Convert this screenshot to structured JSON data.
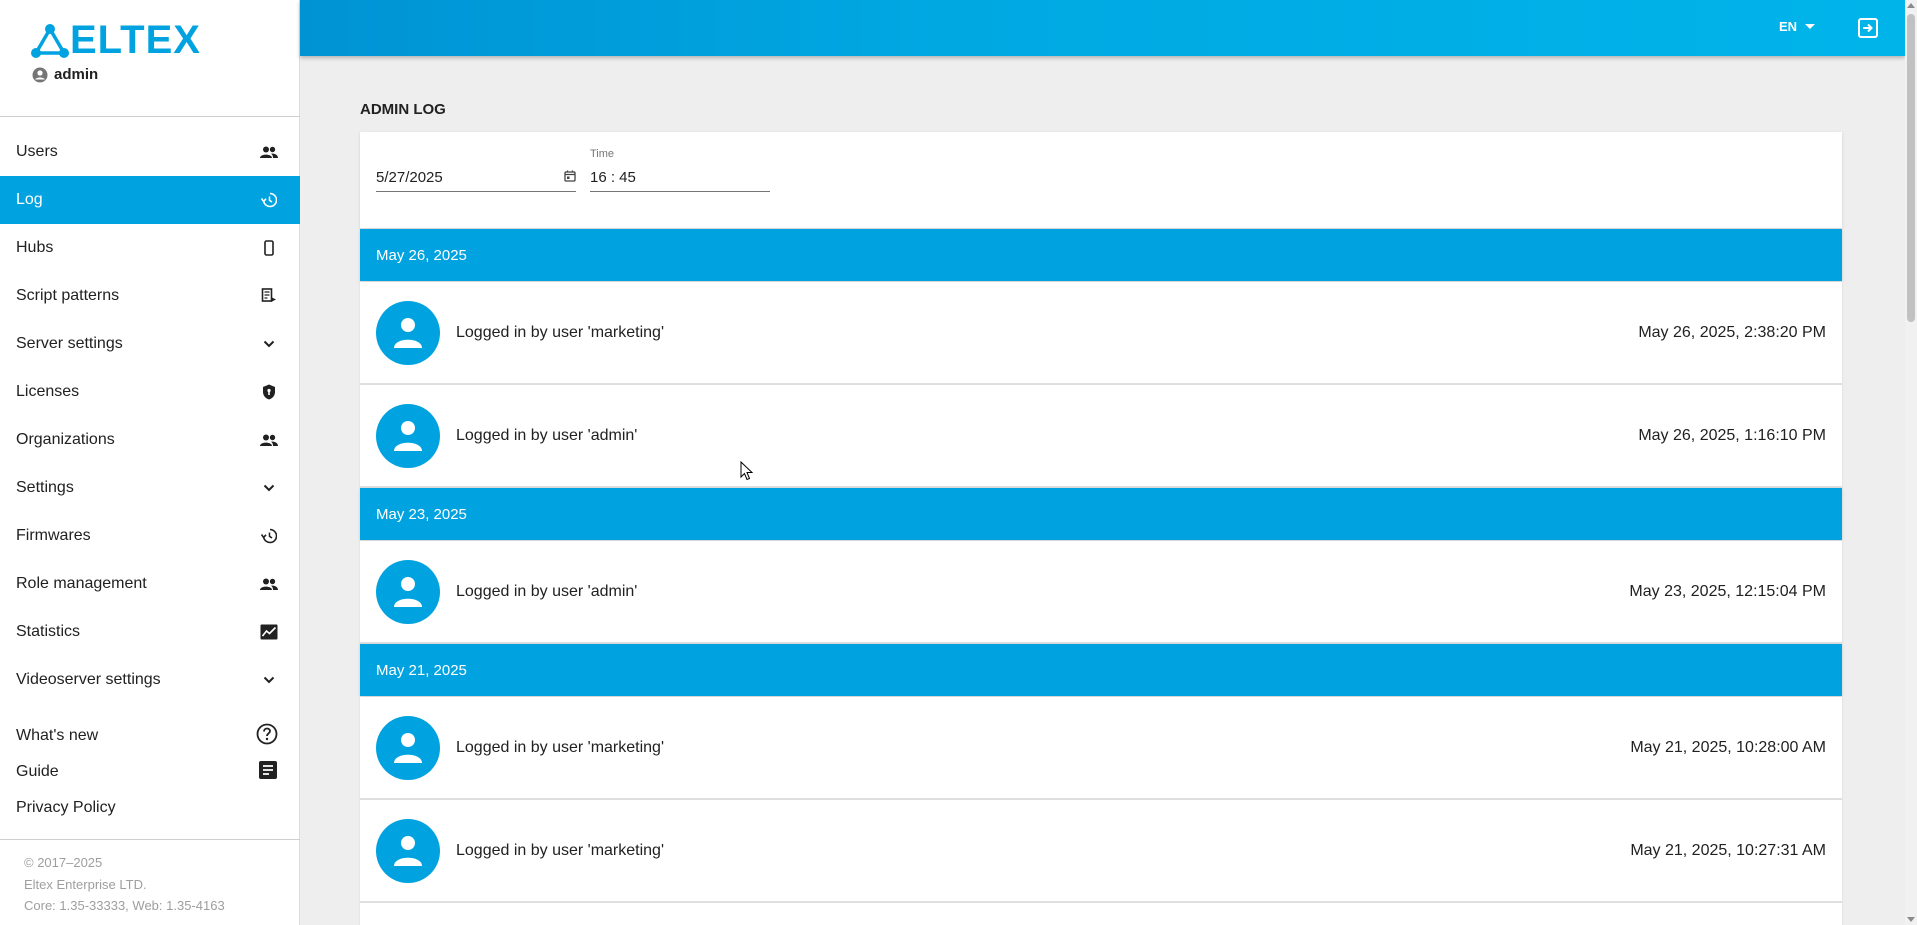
{
  "brand": {
    "logo_text": "ELTEX",
    "accent": "#00a3e0"
  },
  "user": {
    "name": "admin"
  },
  "sidebar": {
    "items": [
      {
        "label": "Users",
        "icon": "people-icon",
        "active": false
      },
      {
        "label": "Log",
        "icon": "history-icon",
        "active": true
      },
      {
        "label": "Hubs",
        "icon": "phone-icon",
        "active": false
      },
      {
        "label": "Script patterns",
        "icon": "script-icon",
        "active": false
      },
      {
        "label": "Server settings",
        "icon": "chevron-down-icon",
        "active": false
      },
      {
        "label": "Licenses",
        "icon": "shield-icon",
        "active": false
      },
      {
        "label": "Organizations",
        "icon": "people-icon",
        "active": false
      },
      {
        "label": "Settings",
        "icon": "chevron-down-icon",
        "active": false
      },
      {
        "label": "Firmwares",
        "icon": "history-icon",
        "active": false
      },
      {
        "label": "Role management",
        "icon": "people-icon",
        "active": false
      },
      {
        "label": "Statistics",
        "icon": "chart-icon",
        "active": false
      },
      {
        "label": "Videoserver settings",
        "icon": "chevron-down-icon",
        "active": false
      }
    ],
    "secondary": [
      {
        "label": "What's new",
        "icon": "help-circle-icon"
      },
      {
        "label": "Guide",
        "icon": "document-icon"
      },
      {
        "label": "Privacy Policy"
      }
    ],
    "footer": {
      "copyright": "© 2017–2025",
      "company": "Eltex Enterprise LTD.",
      "version": "Core: 1.35-33333, Web: 1.35-4163"
    }
  },
  "topbar": {
    "language": "EN"
  },
  "main": {
    "title": "ADMIN LOG",
    "filter": {
      "date_value": "5/27/2025",
      "time_label": "Time",
      "time_value": "16 : 45"
    },
    "groups": [
      {
        "date": "May 26, 2025",
        "entries": [
          {
            "text": "Logged in by user 'marketing'",
            "time": "May 26, 2025, 2:38:20 PM"
          },
          {
            "text": "Logged in by user 'admin'",
            "time": "May 26, 2025, 1:16:10 PM"
          }
        ]
      },
      {
        "date": "May 23, 2025",
        "entries": [
          {
            "text": "Logged in by user 'admin'",
            "time": "May 23, 2025, 12:15:04 PM"
          }
        ]
      },
      {
        "date": "May 21, 2025",
        "entries": [
          {
            "text": "Logged in by user 'marketing'",
            "time": "May 21, 2025, 10:28:00 AM"
          },
          {
            "text": "Logged in by user 'marketing'",
            "time": "May 21, 2025, 10:27:31 AM"
          }
        ]
      }
    ]
  }
}
